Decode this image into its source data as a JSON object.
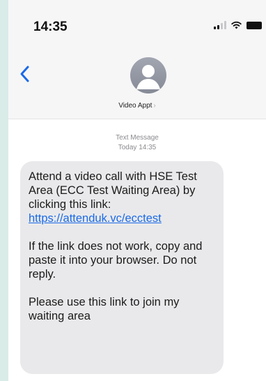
{
  "status_bar": {
    "time": "14:35",
    "icons": [
      "cellular-signal-icon",
      "wifi-icon",
      "battery-icon"
    ]
  },
  "header": {
    "back_icon": "chevron-left-icon",
    "avatar_icon": "person-avatar-icon",
    "contact_name": "Video Appt",
    "contact_chevron": "›"
  },
  "thread": {
    "service_label": "Text Message",
    "timestamp": "Today 14:35"
  },
  "message": {
    "paragraph1_text": "Attend a video call with HSE Test Area (ECC Test Waiting Area) by clicking this link: ",
    "link_text": "https://attenduk.vc/ecctest",
    "paragraph2": "If the link does not work, copy and paste it into your browser. Do not reply.",
    "paragraph3": "Please use this link to join my waiting area"
  },
  "colors": {
    "page_background": "#d9ece8",
    "bubble_background": "#e9e9eb",
    "link": "#1a6ae8",
    "accent": "#1a6ae8"
  }
}
